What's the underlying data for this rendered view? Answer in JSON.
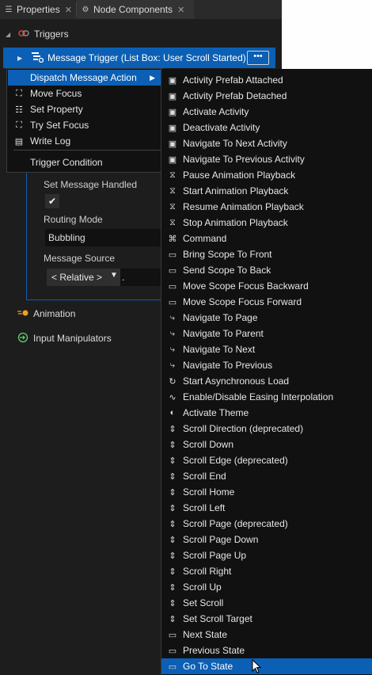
{
  "tabs": [
    {
      "label": "Properties",
      "icon": "properties-icon"
    },
    {
      "label": "Node Components",
      "icon": "node-components-icon"
    }
  ],
  "tab_close": "✕",
  "sections": {
    "triggers": "Triggers",
    "animation": "Animation",
    "input_manipulators": "Input Manipulators"
  },
  "trigger": {
    "label": "Message Trigger (List Box: User Scroll Started)",
    "more": "•••"
  },
  "action_fields": {
    "set_message_handled": "Set Message Handled",
    "checkmark": "✔",
    "routing_mode_label": "Routing Mode",
    "routing_mode_value": "Bubbling",
    "message_source_label": "Message Source",
    "message_source_value": "< Relative >",
    "message_source_path": "."
  },
  "context_menu": {
    "items": [
      {
        "label": "Dispatch Message Action",
        "icon": "",
        "submenu": "▶"
      },
      {
        "label": "Move Focus",
        "icon": "move-focus-icon"
      },
      {
        "label": "Set Property",
        "icon": "set-property-icon"
      },
      {
        "label": "Try Set Focus",
        "icon": "try-set-focus-icon"
      },
      {
        "label": "Write Log",
        "icon": "write-log-icon"
      },
      {
        "label": "Trigger Condition",
        "icon": ""
      }
    ]
  },
  "submenu": {
    "items": [
      "Activity Prefab Attached",
      "Activity Prefab Detached",
      "Activate Activity",
      "Deactivate Activity",
      "Navigate To Next Activity",
      "Navigate To Previous Activity",
      "Pause Animation Playback",
      "Start Animation Playback",
      "Resume Animation Playback",
      "Stop Animation Playback",
      "Command",
      "Bring Scope To Front",
      "Send Scope To Back",
      "Move Scope Focus Backward",
      "Move Scope Focus Forward",
      "Navigate To Page",
      "Navigate To Parent",
      "Navigate To Next",
      "Navigate To Previous",
      "Start Asynchronous Load",
      "Enable/Disable Easing Interpolation",
      "Activate Theme",
      "Scroll Direction (deprecated)",
      "Scroll Down",
      "Scroll Edge (deprecated)",
      "Scroll End",
      "Scroll Home",
      "Scroll Left",
      "Scroll Page (deprecated)",
      "Scroll Page Down",
      "Scroll Page Up",
      "Scroll Right",
      "Scroll Up",
      "Set Scroll",
      "Set Scroll Target",
      "Next State",
      "Previous State",
      "Go To State"
    ],
    "icons": [
      "activity-icon",
      "activity-icon",
      "activity-icon",
      "activity-icon",
      "activity-icon",
      "activity-icon",
      "animation-icon",
      "animation-icon",
      "animation-icon",
      "animation-icon",
      "command-icon",
      "scope-icon",
      "scope-icon",
      "scope-icon",
      "scope-icon",
      "navigation-icon",
      "navigation-icon",
      "navigation-icon",
      "navigation-icon",
      "async-load-icon",
      "easing-icon",
      "theme-icon",
      "scroll-icon",
      "scroll-icon",
      "scroll-icon",
      "scroll-icon",
      "scroll-icon",
      "scroll-icon",
      "scroll-icon",
      "scroll-icon",
      "scroll-icon",
      "scroll-icon",
      "scroll-icon",
      "scroll-icon",
      "scroll-icon",
      "state-icon",
      "state-icon",
      "state-icon"
    ],
    "highlighted": "Go To State"
  },
  "colors": {
    "accent": "#0b5fb4",
    "panel": "#1d1d1d",
    "menu": "#111111"
  }
}
